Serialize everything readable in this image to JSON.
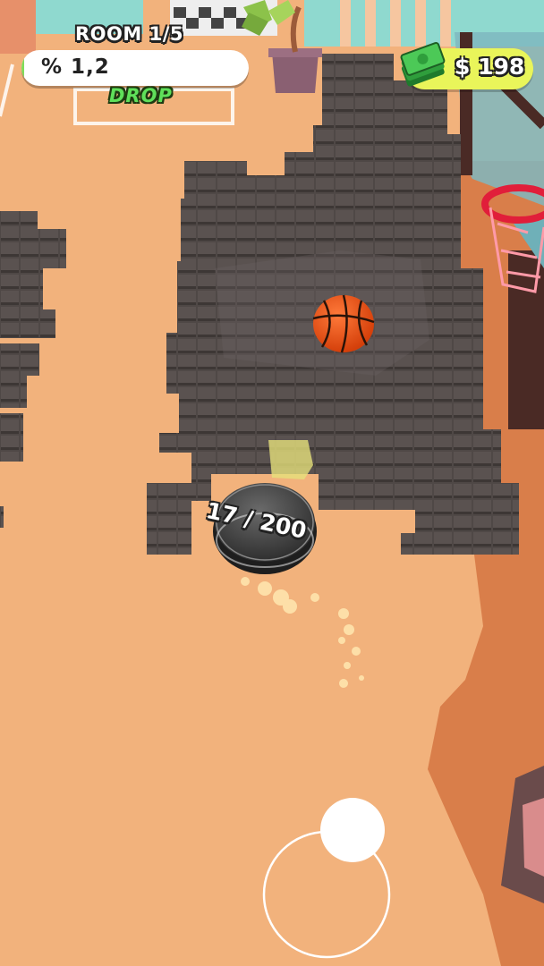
{
  "hud": {
    "room_label": "ROOM 1/5",
    "progress_text": "% 1,2",
    "progress_percent": 1.2,
    "drop_label": "DROP",
    "money_text": "$ 198",
    "money_icon": "cash-stack-icon"
  },
  "robot": {
    "counter_text": "17 / 200"
  },
  "colors": {
    "floor": "#f2b27c",
    "dirt_tile": "#4f4846",
    "money_pill": "#e9f55a",
    "drop_text": "#5fe05a",
    "progress_fill": "#7fdc5a"
  }
}
